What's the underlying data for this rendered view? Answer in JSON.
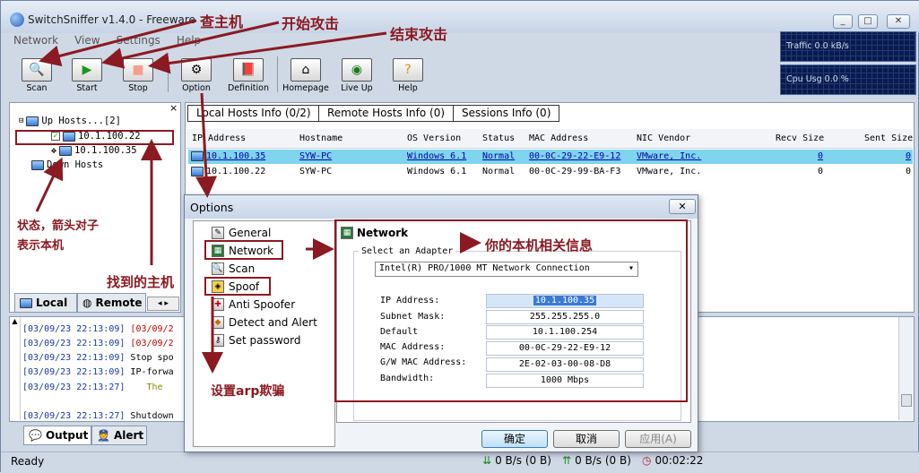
{
  "app": {
    "title": "SwitchSniffer v1.4.0 - Freeware",
    "win_buttons": [
      "_",
      "□",
      "✕"
    ]
  },
  "menu": [
    "Network",
    "View",
    "Settings",
    "Help"
  ],
  "toolbar": {
    "scan": "Scan",
    "start": "Start",
    "stop": "Stop",
    "option": "Option",
    "definition": "Definition",
    "homepage": "Homepage",
    "live_up": "Live Up",
    "help": "Help"
  },
  "monitors": {
    "traffic": "Traffic 0.0 kB/s",
    "cpu": "Cpu Usg 0.0 %"
  },
  "tree": {
    "close": "×",
    "up_hosts": "Up Hosts...[2]",
    "host1": "10.1.100.22",
    "host2": "10.1.100.35",
    "down_hosts": "Down Hosts"
  },
  "left_tabs": {
    "local": "Local",
    "remote": "Remote"
  },
  "tabs": [
    "Local Hosts Info (0/2)",
    "Remote Hosts Info (0)",
    "Sessions Info (0)"
  ],
  "table": {
    "headers": [
      "IP Address",
      "Hostname",
      "OS Version",
      "Status",
      "MAC Address",
      "NIC Vendor",
      "Recv Size",
      "Sent Size"
    ],
    "rows": [
      {
        "ip": "10.1.100.35",
        "host": "SYW-PC",
        "os": "Windows 6.1",
        "status": "Normal",
        "mac": "00-0C-29-22-E9-12",
        "vendor": "VMware, Inc.",
        "recv": "0",
        "sent": "0"
      },
      {
        "ip": "10.1.100.22",
        "host": "SYW-PC",
        "os": "Windows 6.1",
        "status": "Normal",
        "mac": "00-0C-29-99-BA-F3",
        "vendor": "VMware, Inc.",
        "recv": "0",
        "sent": "0"
      }
    ]
  },
  "log": [
    {
      "ts": "[03/09/23 22:13:09]",
      "msg": "[03/09/2"
    },
    {
      "ts": "[03/09/23 22:13:09]",
      "msg": "[03/09/2"
    },
    {
      "ts": "[03/09/23 22:13:09]",
      "msg": "Stop spo"
    },
    {
      "ts": "[03/09/23 22:13:09]",
      "msg": "IP-forwa"
    },
    {
      "ts": "[03/09/23 22:13:27]",
      "msg": "The"
    },
    {
      "ts": "[03/09/23 22:13:27]",
      "msg": "Shutdown"
    }
  ],
  "out_tabs": {
    "output": "Output",
    "alert": "Alert"
  },
  "status": {
    "ready": "Ready",
    "down": "0 B/s (0 B)",
    "up": "0 B/s (0 B)",
    "time": "00:02:22"
  },
  "dialog": {
    "title": "Options",
    "close": "✕",
    "nav": [
      "General",
      "Network",
      "Scan",
      "Spoof",
      "Anti Spoofer",
      "Detect and Alert",
      "Set password"
    ],
    "panel_title": "Network",
    "adapter_label": "Select an Adapter",
    "adapter": "Intel(R) PRO/1000 MT Network Connection",
    "fields": [
      {
        "label": "IP Address:",
        "value": "10.1.100.35"
      },
      {
        "label": "Subnet Mask:",
        "value": "255.255.255.0"
      },
      {
        "label": "Default",
        "value": "10.1.100.254"
      },
      {
        "label": "MAC Address:",
        "value": "00-0C-29-22-E9-12"
      },
      {
        "label": "G/W MAC Address:",
        "value": "2E-02-03-00-08-D8"
      },
      {
        "label": "Bandwidth:",
        "value": "1000 Mbps"
      }
    ],
    "ok": "确定",
    "cancel": "取消",
    "apply": "应用(A)"
  },
  "annotations": {
    "find_host": "查主机",
    "start_attack": "开始攻击",
    "stop_attack": "结束攻击",
    "state": "状态，箭头对子",
    "state2": "表示本机",
    "found": "找到的主机",
    "local_info": "你的本机相关信息",
    "set_arp": "设置arp欺骗"
  },
  "colors": {
    "annotation": "#8b1a22",
    "selected_row": "#7fd4ee"
  }
}
